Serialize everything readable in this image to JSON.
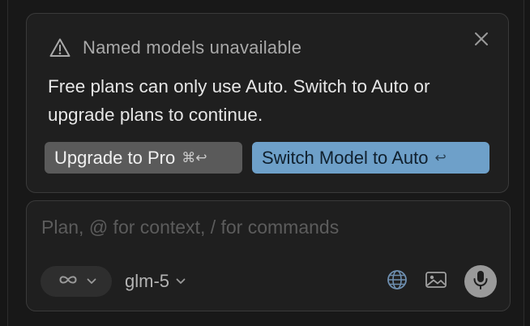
{
  "alert": {
    "icon": "warning-triangle-icon",
    "title": "Named models unavailable",
    "body": "Free plans can only use Auto. Switch to Auto or upgrade plans to continue.",
    "close_icon": "close-icon",
    "upgrade_button": {
      "label": "Upgrade to Pro",
      "shortcut": "⌘↩"
    },
    "switch_button": {
      "label": "Switch Model to Auto",
      "shortcut": "↩"
    }
  },
  "composer": {
    "placeholder": "Plan, @ for context, / for commands",
    "value": "",
    "mode_icon": "infinity-icon",
    "model": "glm-5",
    "tools": [
      "globe-icon",
      "image-icon",
      "microphone-icon"
    ]
  },
  "colors": {
    "background": "#181818",
    "card": "#1f1f1f",
    "border": "#3a3a3a",
    "upgrade_button": "#5a5a5a",
    "switch_button": "#6ea0c9",
    "mic_button": "#9a9a9a"
  }
}
